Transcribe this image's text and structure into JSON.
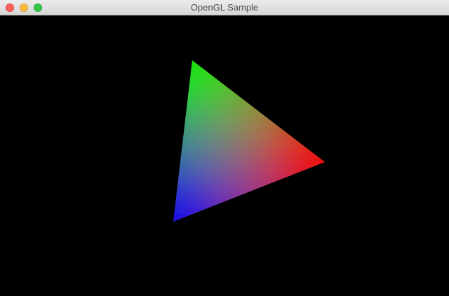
{
  "window": {
    "title": "OpenGL Sample"
  },
  "titlebar": {
    "buttons": [
      {
        "name": "close",
        "color": "#fc605c"
      },
      {
        "name": "minimize",
        "color": "#fdbc40"
      },
      {
        "name": "zoom",
        "color": "#34c84a"
      }
    ]
  },
  "scene": {
    "background": "#000000",
    "triangle_vertex_colors": [
      "#00ff00",
      "#ff0000",
      "#0000ff"
    ]
  }
}
